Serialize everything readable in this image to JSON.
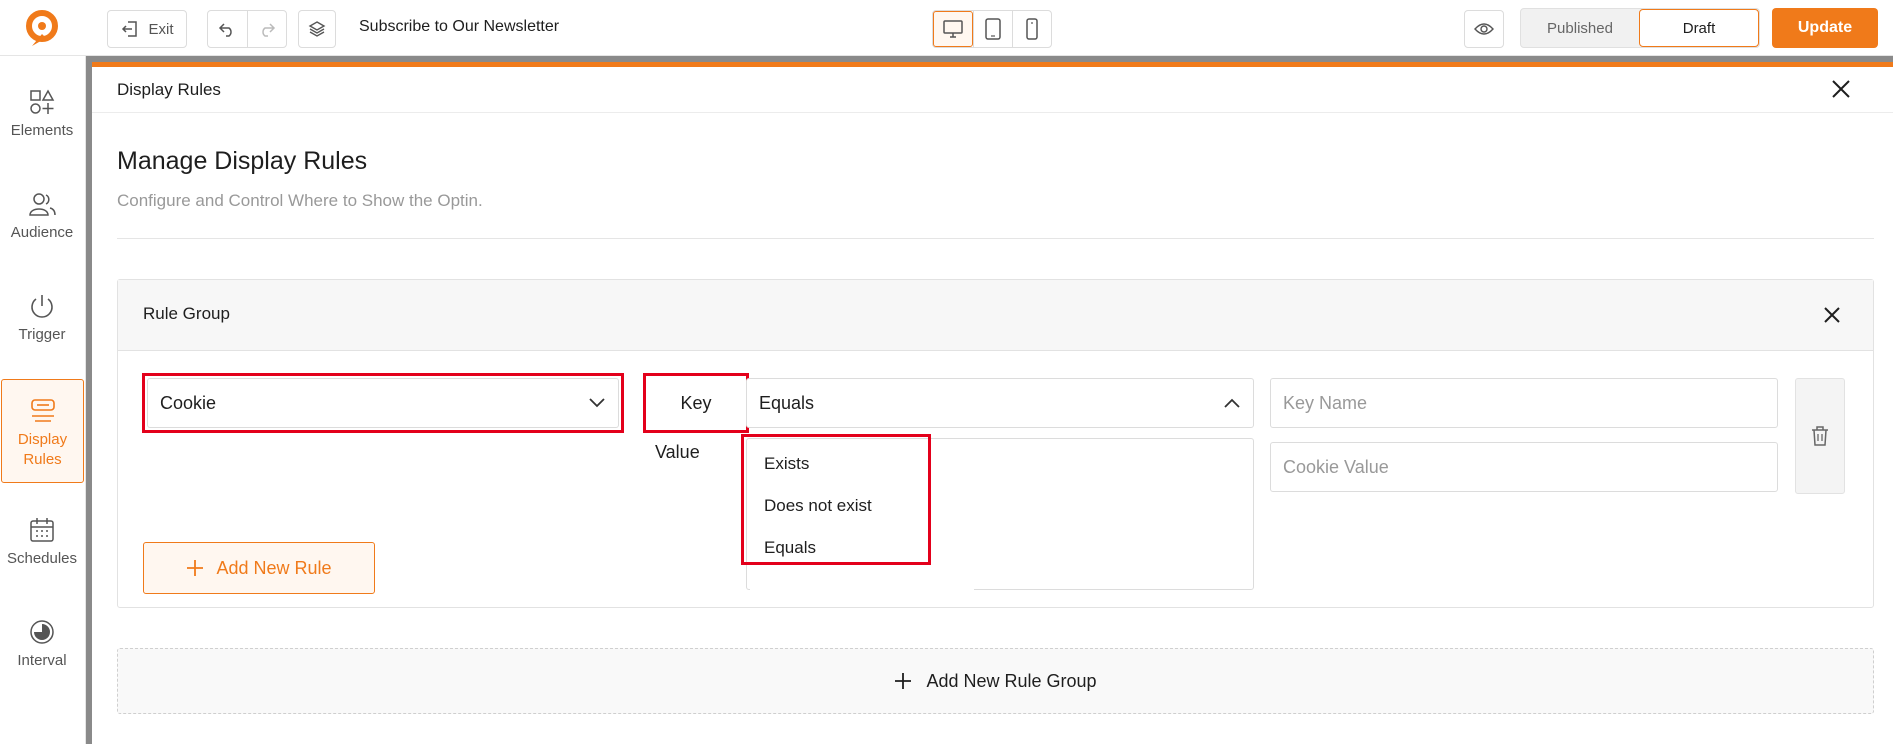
{
  "app": {
    "page_title": "Subscribe to Our Newsletter",
    "accent_color": "#f07a1a",
    "highlight_color": "#e3001b"
  },
  "toolbar": {
    "exit_label": "Exit",
    "undo_icon": "undo-icon",
    "redo_icon": "redo-icon",
    "layers_icon": "layers-icon",
    "devices": [
      "desktop",
      "tablet",
      "mobile"
    ],
    "active_device": "desktop",
    "status_tabs": [
      "Published",
      "Draft"
    ],
    "active_status": "Draft",
    "update_label": "Update"
  },
  "sidebar": {
    "items": [
      {
        "label": "Elements",
        "icon": "elements-icon"
      },
      {
        "label": "Audience",
        "icon": "audience-icon"
      },
      {
        "label": "Trigger",
        "icon": "power-icon"
      },
      {
        "label": "Display Rules",
        "icon": "display-rules-icon",
        "active": true
      },
      {
        "label": "Schedules",
        "icon": "calendar-icon"
      },
      {
        "label": "Interval",
        "icon": "interval-icon"
      }
    ]
  },
  "modal": {
    "title": "Display Rules",
    "heading": "Manage Display Rules",
    "subheading": "Configure and Control Where to Show the Optin.",
    "rule_group": {
      "title": "Rule Group",
      "rule_type": "Cookie",
      "key_label": "Key",
      "operator": "Equals",
      "value_label": "Value",
      "key_name_placeholder": "Key Name",
      "cookie_value_placeholder": "Cookie Value",
      "operator_options": [
        "Exists",
        "Does not exist",
        "Equals"
      ],
      "add_rule_label": "Add New Rule"
    },
    "add_group_label": "Add New Rule Group"
  }
}
